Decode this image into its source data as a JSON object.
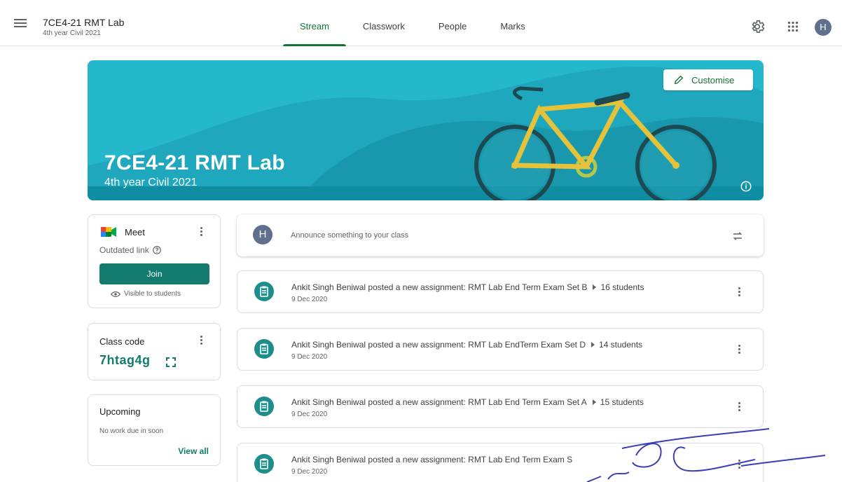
{
  "header": {
    "class_name": "7CE4-21 RMT Lab",
    "class_subtitle": "4th year Civil 2021",
    "tabs": [
      {
        "label": "Stream",
        "active": true
      },
      {
        "label": "Classwork",
        "active": false
      },
      {
        "label": "People",
        "active": false
      },
      {
        "label": "Marks",
        "active": false
      }
    ],
    "avatar_letter": "H",
    "icons": [
      "menu-icon",
      "settings-icon",
      "apps-grid-icon"
    ]
  },
  "banner": {
    "title": "7CE4-21 RMT Lab",
    "subtitle": "4th year Civil 2021",
    "customise_label": "Customise",
    "bg_color": "#25b7cc",
    "illustration": "bicycle"
  },
  "meet": {
    "title": "Meet",
    "status": "Outdated link",
    "join_label": "Join",
    "visibility": "Visible to students"
  },
  "class_code": {
    "label": "Class code",
    "value": "7htag4g"
  },
  "upcoming": {
    "title": "Upcoming",
    "empty_text": "No work due in soon",
    "view_all_label": "View all"
  },
  "announce": {
    "avatar_letter": "H",
    "placeholder": "Announce something to your class"
  },
  "posts": [
    {
      "title": "Ankit Singh Beniwal posted a new assignment: RMT Lab End Term Exam Set B",
      "audience": "16 students",
      "date": "9 Dec 2020"
    },
    {
      "title": "Ankit Singh Beniwal posted a new assignment: RMT Lab EndTerm Exam Set D",
      "audience": "14 students",
      "date": "9 Dec 2020"
    },
    {
      "title": "Ankit Singh Beniwal posted a new assignment: RMT Lab End Term Exam Set A",
      "audience": "15 students",
      "date": "9 Dec 2020"
    },
    {
      "title": "Ankit Singh Beniwal posted a new assignment: RMT Lab End Term Exam S",
      "audience": "",
      "date": "9 Dec 2020"
    }
  ],
  "colors": {
    "accent_green": "#137333",
    "teal": "#137b6e",
    "banner": "#25b7cc"
  }
}
